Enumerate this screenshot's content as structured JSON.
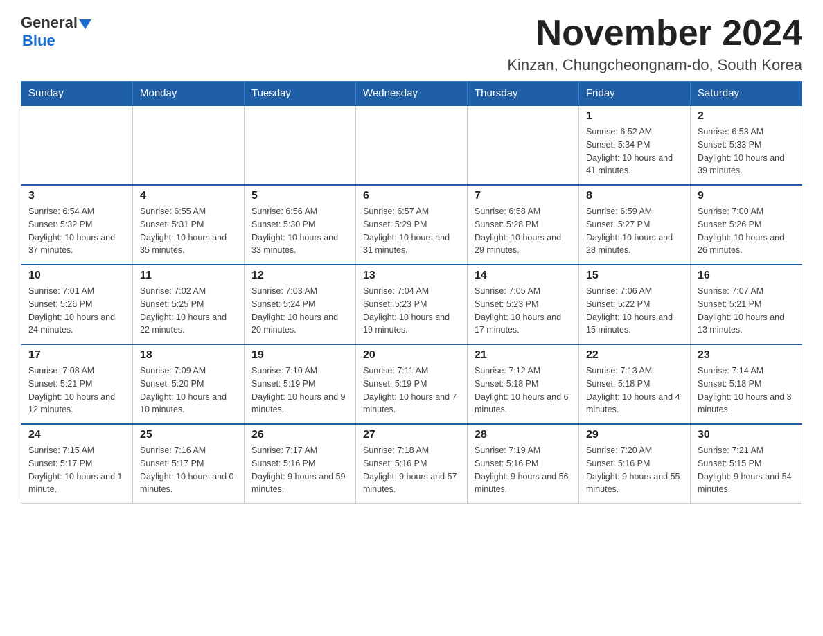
{
  "logo": {
    "text_general": "General",
    "text_blue": "Blue"
  },
  "header": {
    "month_title": "November 2024",
    "location": "Kinzan, Chungcheongnam-do, South Korea"
  },
  "days_of_week": [
    "Sunday",
    "Monday",
    "Tuesday",
    "Wednesday",
    "Thursday",
    "Friday",
    "Saturday"
  ],
  "weeks": [
    {
      "days": [
        {
          "number": "",
          "info": ""
        },
        {
          "number": "",
          "info": ""
        },
        {
          "number": "",
          "info": ""
        },
        {
          "number": "",
          "info": ""
        },
        {
          "number": "",
          "info": ""
        },
        {
          "number": "1",
          "info": "Sunrise: 6:52 AM\nSunset: 5:34 PM\nDaylight: 10 hours and 41 minutes."
        },
        {
          "number": "2",
          "info": "Sunrise: 6:53 AM\nSunset: 5:33 PM\nDaylight: 10 hours and 39 minutes."
        }
      ]
    },
    {
      "days": [
        {
          "number": "3",
          "info": "Sunrise: 6:54 AM\nSunset: 5:32 PM\nDaylight: 10 hours and 37 minutes."
        },
        {
          "number": "4",
          "info": "Sunrise: 6:55 AM\nSunset: 5:31 PM\nDaylight: 10 hours and 35 minutes."
        },
        {
          "number": "5",
          "info": "Sunrise: 6:56 AM\nSunset: 5:30 PM\nDaylight: 10 hours and 33 minutes."
        },
        {
          "number": "6",
          "info": "Sunrise: 6:57 AM\nSunset: 5:29 PM\nDaylight: 10 hours and 31 minutes."
        },
        {
          "number": "7",
          "info": "Sunrise: 6:58 AM\nSunset: 5:28 PM\nDaylight: 10 hours and 29 minutes."
        },
        {
          "number": "8",
          "info": "Sunrise: 6:59 AM\nSunset: 5:27 PM\nDaylight: 10 hours and 28 minutes."
        },
        {
          "number": "9",
          "info": "Sunrise: 7:00 AM\nSunset: 5:26 PM\nDaylight: 10 hours and 26 minutes."
        }
      ]
    },
    {
      "days": [
        {
          "number": "10",
          "info": "Sunrise: 7:01 AM\nSunset: 5:26 PM\nDaylight: 10 hours and 24 minutes."
        },
        {
          "number": "11",
          "info": "Sunrise: 7:02 AM\nSunset: 5:25 PM\nDaylight: 10 hours and 22 minutes."
        },
        {
          "number": "12",
          "info": "Sunrise: 7:03 AM\nSunset: 5:24 PM\nDaylight: 10 hours and 20 minutes."
        },
        {
          "number": "13",
          "info": "Sunrise: 7:04 AM\nSunset: 5:23 PM\nDaylight: 10 hours and 19 minutes."
        },
        {
          "number": "14",
          "info": "Sunrise: 7:05 AM\nSunset: 5:23 PM\nDaylight: 10 hours and 17 minutes."
        },
        {
          "number": "15",
          "info": "Sunrise: 7:06 AM\nSunset: 5:22 PM\nDaylight: 10 hours and 15 minutes."
        },
        {
          "number": "16",
          "info": "Sunrise: 7:07 AM\nSunset: 5:21 PM\nDaylight: 10 hours and 13 minutes."
        }
      ]
    },
    {
      "days": [
        {
          "number": "17",
          "info": "Sunrise: 7:08 AM\nSunset: 5:21 PM\nDaylight: 10 hours and 12 minutes."
        },
        {
          "number": "18",
          "info": "Sunrise: 7:09 AM\nSunset: 5:20 PM\nDaylight: 10 hours and 10 minutes."
        },
        {
          "number": "19",
          "info": "Sunrise: 7:10 AM\nSunset: 5:19 PM\nDaylight: 10 hours and 9 minutes."
        },
        {
          "number": "20",
          "info": "Sunrise: 7:11 AM\nSunset: 5:19 PM\nDaylight: 10 hours and 7 minutes."
        },
        {
          "number": "21",
          "info": "Sunrise: 7:12 AM\nSunset: 5:18 PM\nDaylight: 10 hours and 6 minutes."
        },
        {
          "number": "22",
          "info": "Sunrise: 7:13 AM\nSunset: 5:18 PM\nDaylight: 10 hours and 4 minutes."
        },
        {
          "number": "23",
          "info": "Sunrise: 7:14 AM\nSunset: 5:18 PM\nDaylight: 10 hours and 3 minutes."
        }
      ]
    },
    {
      "days": [
        {
          "number": "24",
          "info": "Sunrise: 7:15 AM\nSunset: 5:17 PM\nDaylight: 10 hours and 1 minute."
        },
        {
          "number": "25",
          "info": "Sunrise: 7:16 AM\nSunset: 5:17 PM\nDaylight: 10 hours and 0 minutes."
        },
        {
          "number": "26",
          "info": "Sunrise: 7:17 AM\nSunset: 5:16 PM\nDaylight: 9 hours and 59 minutes."
        },
        {
          "number": "27",
          "info": "Sunrise: 7:18 AM\nSunset: 5:16 PM\nDaylight: 9 hours and 57 minutes."
        },
        {
          "number": "28",
          "info": "Sunrise: 7:19 AM\nSunset: 5:16 PM\nDaylight: 9 hours and 56 minutes."
        },
        {
          "number": "29",
          "info": "Sunrise: 7:20 AM\nSunset: 5:16 PM\nDaylight: 9 hours and 55 minutes."
        },
        {
          "number": "30",
          "info": "Sunrise: 7:21 AM\nSunset: 5:15 PM\nDaylight: 9 hours and 54 minutes."
        }
      ]
    }
  ]
}
